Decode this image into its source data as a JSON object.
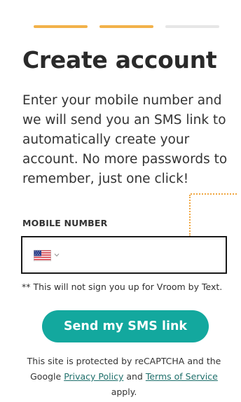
{
  "progress": {
    "steps": 3,
    "completed": 2,
    "active_color": "#f2b24a",
    "inactive_color": "#e6e6e6"
  },
  "title": "Create account",
  "description": "Enter your mobile number and we will send you an SMS link to automatically create your account. No more passwords to remember, just one click!",
  "mobile_field": {
    "label": "MOBILE NUMBER",
    "country_icon": "us-flag-icon",
    "dropdown_icon": "chevron-down-icon",
    "value": "",
    "placeholder": ""
  },
  "disclaimer": "** This will not sign you up for Vroom by Text.",
  "cta_label": "Send my SMS link",
  "recaptcha": {
    "text_before": "This site is protected by reCAPTCHA and the Google ",
    "privacy_label": "Privacy Policy",
    "text_middle": " and ",
    "terms_label": "Terms of Service",
    "text_after": " apply."
  },
  "colors": {
    "accent": "#13a89e",
    "dotted_line": "#f0a640",
    "link": "#1e6f6b"
  }
}
